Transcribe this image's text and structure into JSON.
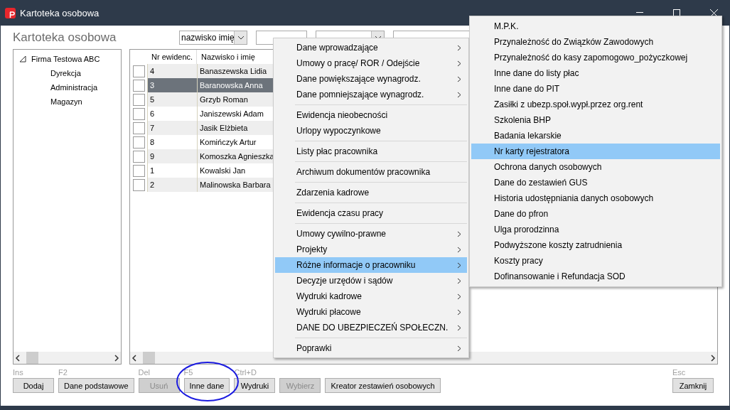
{
  "window": {
    "title": "Kartoteka osobowa"
  },
  "heading": "Kartoteka osobowa",
  "filters": {
    "sort_combo": "nazwisko imię"
  },
  "tree": [
    {
      "label": "Firma Testowa ABC",
      "expanded": true,
      "children": [
        {
          "label": "Dyrekcja"
        },
        {
          "label": "Administracja"
        },
        {
          "label": "Magazyn"
        }
      ]
    }
  ],
  "table": {
    "columns": [
      "Nr ewidenc.",
      "Nazwisko i imię"
    ],
    "rows": [
      {
        "number": "4",
        "name": "Banaszewska Lidia",
        "checked": false,
        "selected": false
      },
      {
        "number": "3",
        "name": "Baranowska Anna",
        "checked": false,
        "selected": true
      },
      {
        "number": "5",
        "name": "Grzyb Roman",
        "checked": false,
        "selected": false
      },
      {
        "number": "6",
        "name": "Janiszewski Adam",
        "checked": false,
        "selected": false
      },
      {
        "number": "7",
        "name": "Jasik Elżbieta",
        "checked": false,
        "selected": false
      },
      {
        "number": "8",
        "name": "Komińczyk Artur",
        "checked": false,
        "selected": false
      },
      {
        "number": "9",
        "name": "Komoszka Agnieszka",
        "checked": false,
        "selected": false
      },
      {
        "number": "1",
        "name": "Kowalski Jan",
        "checked": false,
        "selected": false
      },
      {
        "number": "2",
        "name": "Malinowska Barbara",
        "checked": false,
        "selected": false
      }
    ]
  },
  "buttons": [
    {
      "hint": "Ins",
      "label": "Dodaj",
      "disabled": false,
      "circled": false
    },
    {
      "hint": "F2",
      "label": "Dane podstawowe",
      "disabled": false,
      "circled": false
    },
    {
      "hint": "Del",
      "label": "Usuń",
      "disabled": true,
      "circled": false
    },
    {
      "hint": "F5",
      "label": "Inne dane",
      "disabled": false,
      "circled": true
    },
    {
      "hint": "Ctrl+D",
      "label": "Wydruki",
      "disabled": false,
      "circled": false
    },
    {
      "label": "Wybierz",
      "disabled": true,
      "circled": false
    },
    {
      "label": "Kreator zestawień osobowych",
      "disabled": false,
      "circled": false
    }
  ],
  "close_button": {
    "hint": "Esc",
    "label": "Zamknij"
  },
  "context_menu": {
    "groups": [
      [
        {
          "label": "Dane wprowadzające",
          "has_submenu": true,
          "selected": false
        },
        {
          "label": "Umowy o pracę/ ROR / Odejście",
          "has_submenu": true,
          "selected": false
        },
        {
          "label": "Dane powiększające wynagrodz.",
          "has_submenu": true,
          "selected": false
        },
        {
          "label": "Dane pomniejszające wynagrodz.",
          "has_submenu": true,
          "selected": false
        }
      ],
      [
        {
          "label": "Ewidencja nieobecności",
          "has_submenu": false,
          "selected": false
        },
        {
          "label": "Urlopy wypoczynkowe",
          "has_submenu": false,
          "selected": false
        }
      ],
      [
        {
          "label": "Listy płac pracownika",
          "has_submenu": false,
          "selected": false
        }
      ],
      [
        {
          "label": "Archiwum dokumentów pracownika",
          "has_submenu": false,
          "selected": false
        }
      ],
      [
        {
          "label": "Zdarzenia kadrowe",
          "has_submenu": false,
          "selected": false
        }
      ],
      [
        {
          "label": "Ewidencja czasu pracy",
          "has_submenu": false,
          "selected": false
        }
      ],
      [
        {
          "label": "Umowy cywilno-prawne",
          "has_submenu": true,
          "selected": false
        },
        {
          "label": "Projekty",
          "has_submenu": true,
          "selected": false
        },
        {
          "label": "Różne informacje o pracowniku",
          "has_submenu": true,
          "selected": true
        },
        {
          "label": "Decyzje urzędów i sądów",
          "has_submenu": true,
          "selected": false
        },
        {
          "label": "Wydruki kadrowe",
          "has_submenu": true,
          "selected": false
        },
        {
          "label": "Wydruki płacowe",
          "has_submenu": true,
          "selected": false
        },
        {
          "label": "DANE DO UBEZPIECZEŃ SPOŁECZN.",
          "has_submenu": true,
          "selected": false
        }
      ],
      [
        {
          "label": "Poprawki",
          "has_submenu": true,
          "selected": false
        }
      ]
    ]
  },
  "submenu": {
    "items": [
      {
        "label": "M.P.K.",
        "selected": false
      },
      {
        "label": "Przynależność do Związków Zawodowych",
        "selected": false
      },
      {
        "label": "Przynależność do kasy zapomogowo_pożyczkowej",
        "selected": false
      },
      {
        "label": "Inne dane do listy płac",
        "selected": false
      },
      {
        "label": "Inne dane do PIT",
        "selected": false
      },
      {
        "label": "Zasiłki z ubezp.społ.wypł.przez org.rent",
        "selected": false
      },
      {
        "label": "Szkolenia BHP",
        "selected": false
      },
      {
        "label": "Badania lekarskie",
        "selected": false
      },
      {
        "label": "Nr karty rejestratora",
        "selected": true
      },
      {
        "label": "Ochrona danych osobowych",
        "selected": false
      },
      {
        "label": "Dane do zestawień GUS",
        "selected": false
      },
      {
        "label": "Historia udostępniania danych osobowych",
        "selected": false
      },
      {
        "label": "Dane do pfron",
        "selected": false
      },
      {
        "label": "Ulga prorodzinna",
        "selected": false
      },
      {
        "label": "Podwyższone koszty zatrudnienia",
        "selected": false
      },
      {
        "label": "Koszty pracy",
        "selected": false
      },
      {
        "label": "Dofinansowanie i Refundacja SOD",
        "selected": false
      }
    ]
  }
}
